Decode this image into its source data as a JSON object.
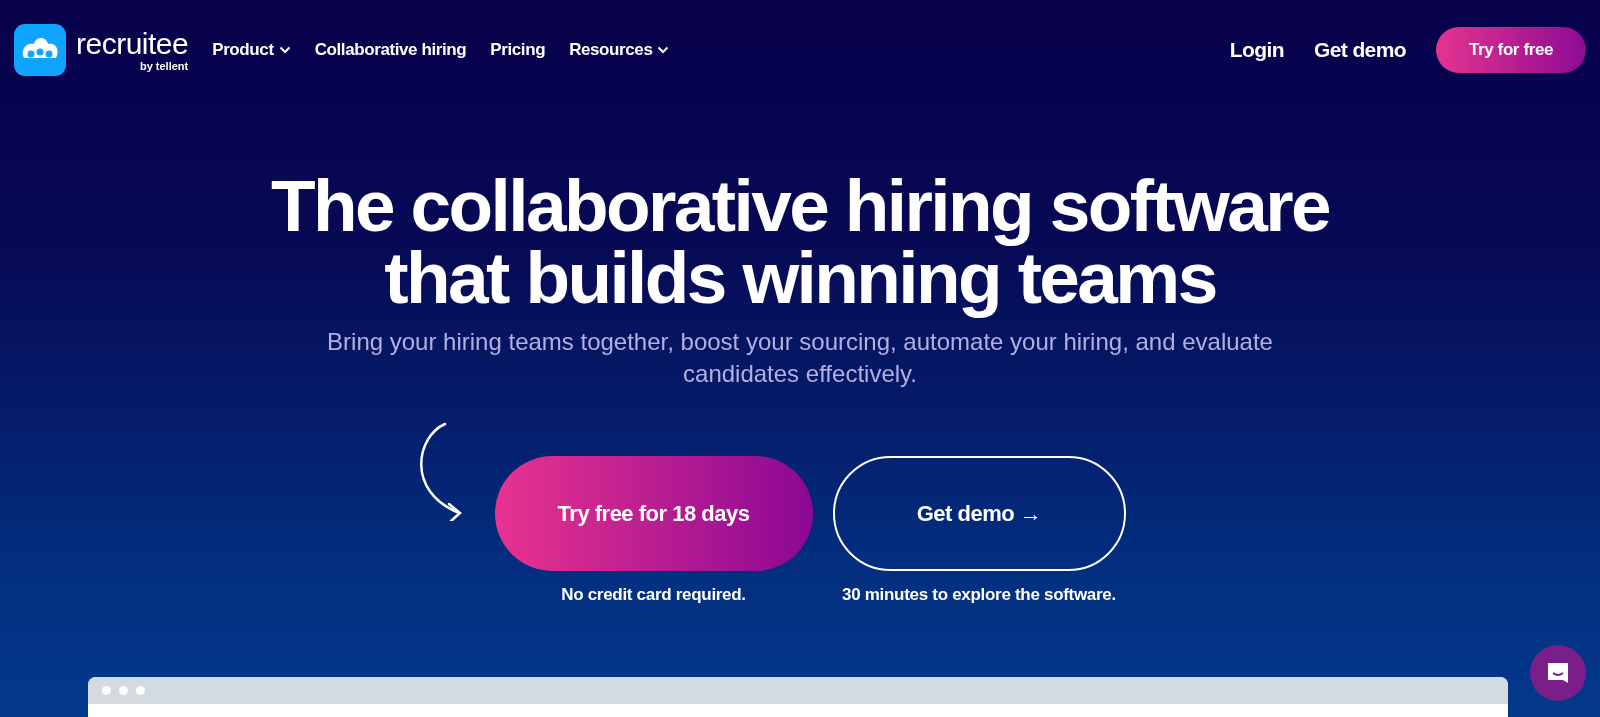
{
  "brand": {
    "name": "recruitee",
    "byline": "by tellent"
  },
  "nav": [
    {
      "label": "Product",
      "dropdown": true
    },
    {
      "label": "Collaborative hiring",
      "dropdown": false
    },
    {
      "label": "Pricing",
      "dropdown": false
    },
    {
      "label": "Resources",
      "dropdown": true
    }
  ],
  "header_actions": {
    "login": "Login",
    "demo": "Get demo",
    "trial": "Try for free"
  },
  "hero": {
    "title_lines": [
      "The collaborative hiring software",
      "that builds winning teams"
    ],
    "subtitle": "Bring your hiring teams together, boost your sourcing, automate your hiring, and evaluate candidates effectively.",
    "ctas": [
      {
        "kind": "primary",
        "label": "Try free for 18 days",
        "note": "No credit card required."
      },
      {
        "kind": "outline",
        "label": "Get demo →",
        "note": "30 minutes to explore the software."
      }
    ]
  }
}
